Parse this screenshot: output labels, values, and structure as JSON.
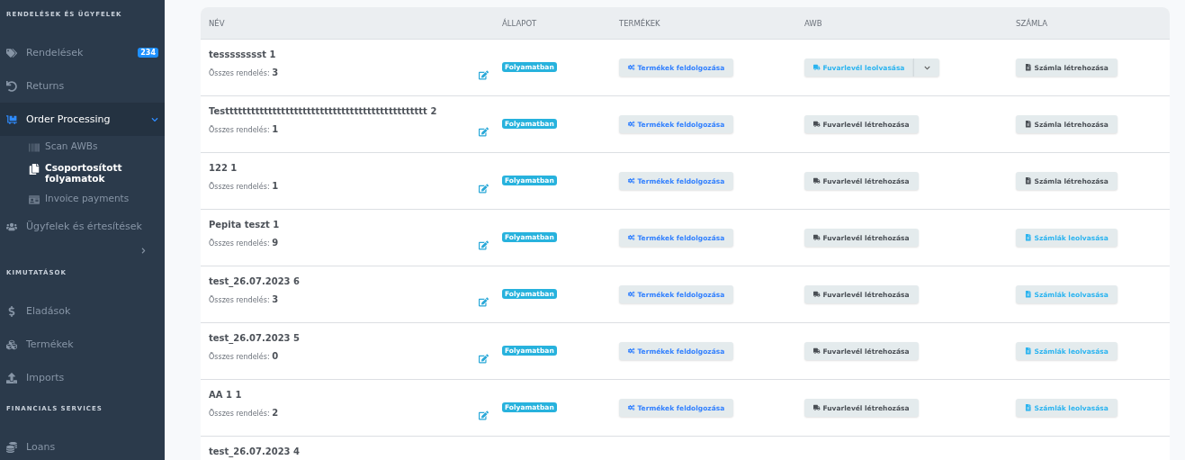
{
  "sidebar": {
    "sections": [
      {
        "title": "RENDELÉSEK ÉS ÜGYFELEK",
        "items": [
          {
            "label": "Rendelések",
            "badge": "234",
            "selected": false
          },
          {
            "label": "Returns",
            "selected": false
          },
          {
            "label": "Order Processing",
            "selected": true,
            "expanded": true,
            "children": [
              {
                "label": "Scan AWBs",
                "selected": false
              },
              {
                "label": "Csoportosított folyamatok",
                "selected": true
              },
              {
                "label": "Invoice payments",
                "selected": false
              }
            ]
          },
          {
            "label": "Ügyfelek és értesítések",
            "selected": false,
            "expanded": false
          }
        ]
      },
      {
        "title": "KIMUTATÁSOK",
        "items": [
          {
            "label": "Eladások",
            "selected": false
          },
          {
            "label": "Termékek",
            "selected": false
          },
          {
            "label": "Imports",
            "selected": false
          }
        ]
      },
      {
        "title": "FINANCIALS SERVICES",
        "items": [
          {
            "label": "Loans",
            "selected": false
          }
        ]
      }
    ]
  },
  "table": {
    "columns": [
      "NÉV",
      "ÁLLAPOT",
      "TERMÉKEK",
      "AWB",
      "SZÁMLA"
    ],
    "rows": [
      {
        "name": "tesssssssst 1",
        "total_label": "Összes rendelés:",
        "total": "3",
        "status": "Folyamatban",
        "products": "Termékek feldolgozása",
        "awb": {
          "kind": "read",
          "label": "Fuvarlevél leolvasása"
        },
        "invoice": {
          "kind": "create",
          "label": "Számla létrehozása"
        }
      },
      {
        "name": "Testtttttttttttttttttttttttttttttttttttttttttttttt 2",
        "total_label": "Összes rendelés:",
        "total": "1",
        "status": "Folyamatban",
        "products": "Termékek feldolgozása",
        "awb": {
          "kind": "create",
          "label": "Fuvarlevél létrehozása"
        },
        "invoice": {
          "kind": "create",
          "label": "Számla létrehozása"
        }
      },
      {
        "name": "122 1",
        "total_label": "Összes rendelés:",
        "total": "1",
        "status": "Folyamatban",
        "products": "Termékek feldolgozása",
        "awb": {
          "kind": "create",
          "label": "Fuvarlevél létrehozása"
        },
        "invoice": {
          "kind": "create",
          "label": "Számla létrehozása"
        }
      },
      {
        "name": "Pepita teszt 1",
        "total_label": "Összes rendelés:",
        "total": "9",
        "status": "Folyamatban",
        "products": "Termékek feldolgozása",
        "awb": {
          "kind": "create",
          "label": "Fuvarlevél létrehozása"
        },
        "invoice": {
          "kind": "read",
          "label": "Számlák leolvasása"
        }
      },
      {
        "name": "test_26.07.2023 6",
        "total_label": "Összes rendelés:",
        "total": "3",
        "status": "Folyamatban",
        "products": "Termékek feldolgozása",
        "awb": {
          "kind": "create",
          "label": "Fuvarlevél létrehozása"
        },
        "invoice": {
          "kind": "read",
          "label": "Számlák leolvasása"
        }
      },
      {
        "name": "test_26.07.2023 5",
        "total_label": "Összes rendelés:",
        "total": "0",
        "status": "Folyamatban",
        "products": "Termékek feldolgozása",
        "awb": {
          "kind": "create",
          "label": "Fuvarlevél létrehozása"
        },
        "invoice": {
          "kind": "read",
          "label": "Számlák leolvasása"
        }
      },
      {
        "name": "AA 1 1",
        "total_label": "Összes rendelés:",
        "total": "2",
        "status": "Folyamatban",
        "products": "Termékek feldolgozása",
        "awb": {
          "kind": "create",
          "label": "Fuvarlevél létrehozása"
        },
        "invoice": {
          "kind": "read",
          "label": "Számlák leolvasása"
        }
      },
      {
        "name": "test_26.07.2023 4"
      }
    ]
  }
}
